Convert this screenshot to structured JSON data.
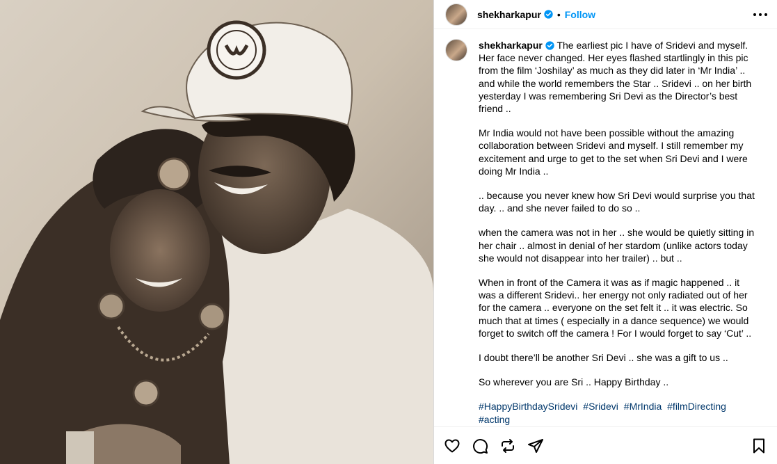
{
  "post": {
    "username": "shekharkapur",
    "follow_label": "Follow",
    "separator": "•",
    "caption_first_line": "The earliest pic I have of Sridevi and myself. Her face never changed. Her eyes flashed startlingly in this pic from the film ‘Joshilay’ as much as they did later in ‘Mr India’ .. and while the world remembers the Star .. Sridevi .. on her birth yesterday I was remembering Sri Devi as the Director’s best friend ..",
    "paragraphs": [
      "Mr India would not have been possible without the amazing collaboration between Sridevi and myself. I still remember my excitement and urge to get to the set when Sri Devi and I were doing Mr India ..",
      ".. because you never knew how Sri Devi would surprise you that day. .. and she never failed to do so ..",
      "when the camera was not in her .. she would be quietly sitting in her chair .. almost in denial of her stardom (unlike actors today she would not disappear into her trailer) .. but ..",
      "When in front of the Camera it was as if magic happened .. it was a different Sridevi.. her energy not only radiated out of her for the camera .. everyone on the set felt it .. it was electric. So much that at times ( especially in a dance sequence) we would forget to switch off the camera ! For I would forget to say ‘Cut’ ..",
      "I doubt there’ll be another Sri Devi .. she was a gift to us ..",
      "So wherever you are Sri .. Happy Birthday .."
    ],
    "hashtags": [
      "#HappyBirthdaySridevi",
      "#Sridevi",
      "#MrIndia",
      "#filmDirecting",
      "#acting"
    ]
  },
  "icons": {
    "verified": "verified-badge-icon",
    "more": "more-options-icon",
    "like": "heart-icon",
    "comment": "comment-icon",
    "repost": "repost-icon",
    "share": "share-icon",
    "save": "bookmark-icon"
  },
  "colors": {
    "link": "#0095f6",
    "hashtag": "#00376b",
    "photo_sepia": "#d7cdbf"
  }
}
